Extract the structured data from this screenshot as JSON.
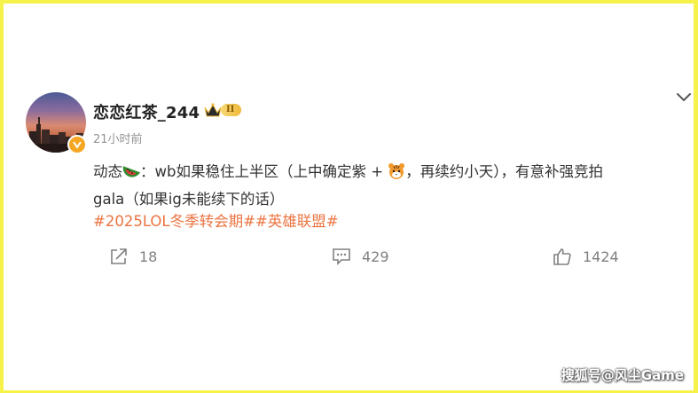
{
  "post": {
    "username": "恋恋红茶_244",
    "level": "II",
    "timestamp": "21小时前",
    "text_part1": "动态",
    "text_part2": "：wb如果稳住上半区（上中确定紫 +",
    "text_part3": "，再续约小天），有意补强竞拍",
    "text_part4": "gala（如果ig未能续下的话）",
    "hashtags": "#2025LOL冬季转会期##英雄联盟#"
  },
  "actions": {
    "share_count": "18",
    "comment_count": "429",
    "like_count": "1424"
  },
  "icons": {
    "avatar": "avatar-image",
    "verified": "verified-badge-icon",
    "crown": "crown-icon",
    "watermelon": "watermelon-emoji-icon",
    "tiger": "tiger-emoji-icon",
    "chevron": "chevron-down-icon",
    "share": "share-icon",
    "comment": "comment-icon",
    "like": "like-icon"
  },
  "colors": {
    "frame": "#f7f24a",
    "hashtag": "#eb7340",
    "meta_text": "#939393"
  },
  "watermark": "搜狐号@风尘Game"
}
